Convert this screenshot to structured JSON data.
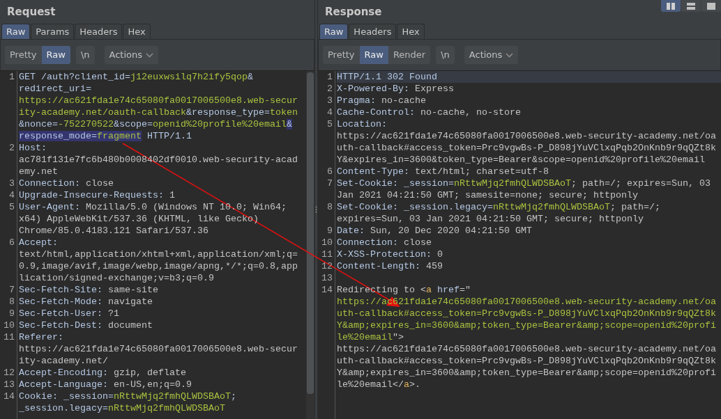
{
  "layout_buttons": [
    {
      "selected": true
    },
    {
      "selected": false
    },
    {
      "selected": false
    }
  ],
  "request": {
    "title": "Request",
    "tabs": [
      {
        "label": "Raw",
        "selected": true
      },
      {
        "label": "Params",
        "selected": false
      },
      {
        "label": "Headers",
        "selected": false
      },
      {
        "label": "Hex",
        "selected": false
      }
    ],
    "view_modes": [
      {
        "label": "Pretty",
        "selected": false
      },
      {
        "label": "Raw",
        "selected": true
      }
    ],
    "newline_button": "\\n",
    "actions_button": "Actions",
    "lines": [
      {
        "number": "1",
        "rows": [
          {
            "tokens": [
              {
                "kind": "key",
                "text": "GET /auth?client_id="
              },
              {
                "kind": "param",
                "text": "j12euxwsilq7h2ify5qop"
              },
              {
                "kind": "key",
                "text": "&"
              }
            ]
          },
          {
            "tokens": [
              {
                "kind": "key",
                "text": "redirect_uri="
              }
            ]
          },
          {
            "tokens": [
              {
                "kind": "param",
                "text": "https://ac621fda1e74c65080fa0017006500e8.web-secur"
              }
            ]
          },
          {
            "tokens": [
              {
                "kind": "param",
                "text": "ity-academy.net/oauth-callback"
              },
              {
                "kind": "key",
                "text": "&response_type="
              },
              {
                "kind": "param",
                "text": "token"
              }
            ]
          },
          {
            "tokens": [
              {
                "kind": "key",
                "text": "&nonce="
              },
              {
                "kind": "param",
                "text": "-752270522"
              },
              {
                "kind": "key",
                "text": "&scope="
              },
              {
                "kind": "param",
                "text": "openid%20profile%20email"
              },
              {
                "kind": "key",
                "text": "&",
                "highlight": true
              }
            ]
          },
          {
            "tokens": [
              {
                "kind": "key",
                "text": "response_mode=",
                "highlight": true
              },
              {
                "kind": "param",
                "text": "fragment",
                "highlight": true
              },
              {
                "kind": "key",
                "text": " HTTP/1.1"
              }
            ]
          }
        ]
      },
      {
        "number": "2",
        "rows": [
          {
            "tokens": [
              {
                "kind": "key",
                "text": "Host:"
              }
            ]
          },
          {
            "tokens": [
              {
                "kind": "text",
                "text": "ac781f131e7fc6b480b0008402df0010.web-security-acad"
              }
            ]
          },
          {
            "tokens": [
              {
                "kind": "text",
                "text": "emy.net"
              }
            ]
          }
        ]
      },
      {
        "number": "3",
        "rows": [
          {
            "tokens": [
              {
                "kind": "key",
                "text": "Connection:"
              },
              {
                "kind": "text",
                "text": " close"
              }
            ]
          }
        ]
      },
      {
        "number": "4",
        "rows": [
          {
            "tokens": [
              {
                "kind": "key",
                "text": "Upgrade-Insecure-Requests:"
              },
              {
                "kind": "text",
                "text": " 1"
              }
            ]
          }
        ]
      },
      {
        "number": "5",
        "rows": [
          {
            "tokens": [
              {
                "kind": "key",
                "text": "User-Agent:"
              },
              {
                "kind": "text",
                "text": " Mozilla/5.0 (Windows NT 10.0; Win64;"
              }
            ]
          },
          {
            "tokens": [
              {
                "kind": "text",
                "text": "x64) AppleWebKit/537.36 (KHTML, like Gecko)"
              }
            ]
          },
          {
            "tokens": [
              {
                "kind": "text",
                "text": "Chrome/85.0.4183.121 Safari/537.36"
              }
            ]
          }
        ]
      },
      {
        "number": "6",
        "rows": [
          {
            "tokens": [
              {
                "kind": "key",
                "text": "Accept:"
              }
            ]
          },
          {
            "tokens": [
              {
                "kind": "text",
                "text": "text/html,application/xhtml+xml,application/xml;q="
              }
            ]
          },
          {
            "tokens": [
              {
                "kind": "text",
                "text": "0.9,image/avif,image/webp,image/apng,*/*;q=0.8,app"
              }
            ]
          },
          {
            "tokens": [
              {
                "kind": "text",
                "text": "lication/signed-exchange;v=b3;q=0.9"
              }
            ]
          }
        ]
      },
      {
        "number": "7",
        "rows": [
          {
            "tokens": [
              {
                "kind": "key",
                "text": "Sec-Fetch-Site:"
              },
              {
                "kind": "text",
                "text": " same-site"
              }
            ]
          }
        ]
      },
      {
        "number": "8",
        "rows": [
          {
            "tokens": [
              {
                "kind": "key",
                "text": "Sec-Fetch-Mode:"
              },
              {
                "kind": "text",
                "text": " navigate"
              }
            ]
          }
        ]
      },
      {
        "number": "9",
        "rows": [
          {
            "tokens": [
              {
                "kind": "key",
                "text": "Sec-Fetch-User:"
              },
              {
                "kind": "text",
                "text": " ?1"
              }
            ]
          }
        ]
      },
      {
        "number": "10",
        "rows": [
          {
            "tokens": [
              {
                "kind": "key",
                "text": "Sec-Fetch-Dest:"
              },
              {
                "kind": "text",
                "text": " document"
              }
            ]
          }
        ]
      },
      {
        "number": "11",
        "rows": [
          {
            "tokens": [
              {
                "kind": "key",
                "text": "Referer:"
              }
            ]
          },
          {
            "tokens": [
              {
                "kind": "text",
                "text": "https://ac621fda1e74c65080fa0017006500e8.web-secur"
              }
            ]
          },
          {
            "tokens": [
              {
                "kind": "text",
                "text": "ity-academy.net/"
              }
            ]
          }
        ]
      },
      {
        "number": "12",
        "rows": [
          {
            "tokens": [
              {
                "kind": "key",
                "text": "Accept-Encoding:"
              },
              {
                "kind": "text",
                "text": " gzip, deflate"
              }
            ]
          }
        ]
      },
      {
        "number": "13",
        "rows": [
          {
            "tokens": [
              {
                "kind": "key",
                "text": "Accept-Language:"
              },
              {
                "kind": "text",
                "text": " en-US,en;q=0.9"
              }
            ]
          }
        ]
      },
      {
        "number": "14",
        "rows": [
          {
            "tokens": [
              {
                "kind": "key",
                "text": "Cookie: _session="
              },
              {
                "kind": "param",
                "text": "nRttwMjq2fmhQLWDSBAoT"
              },
              {
                "kind": "key",
                "text": ";"
              }
            ]
          },
          {
            "tokens": [
              {
                "kind": "key",
                "text": "_session.legacy="
              },
              {
                "kind": "param",
                "text": "nRttwMjq2fmhQLWDSBAoT"
              }
            ]
          }
        ]
      }
    ]
  },
  "response": {
    "title": "Response",
    "tabs": [
      {
        "label": "Raw",
        "selected": true
      },
      {
        "label": "Headers",
        "selected": false
      },
      {
        "label": "Hex",
        "selected": false
      }
    ],
    "view_modes": [
      {
        "label": "Pretty",
        "selected": false
      },
      {
        "label": "Raw",
        "selected": true
      },
      {
        "label": "Render",
        "selected": false
      }
    ],
    "newline_button": "\\n",
    "actions_button": "Actions",
    "lines": [
      {
        "number": "1",
        "current": true,
        "rows": [
          {
            "tokens": [
              {
                "kind": "key",
                "text": "HTTP/1.1 302 Found"
              }
            ]
          }
        ]
      },
      {
        "number": "2",
        "rows": [
          {
            "tokens": [
              {
                "kind": "key",
                "text": "X-Powered-By:"
              },
              {
                "kind": "text",
                "text": " Express"
              }
            ]
          }
        ]
      },
      {
        "number": "3",
        "rows": [
          {
            "tokens": [
              {
                "kind": "key",
                "text": "Pragma:"
              },
              {
                "kind": "text",
                "text": " no-cache"
              }
            ]
          }
        ]
      },
      {
        "number": "4",
        "rows": [
          {
            "tokens": [
              {
                "kind": "key",
                "text": "Cache-Control:"
              },
              {
                "kind": "text",
                "text": " no-cache, no-store"
              }
            ]
          }
        ]
      },
      {
        "number": "5",
        "rows": [
          {
            "tokens": [
              {
                "kind": "key",
                "text": "Location:"
              }
            ]
          },
          {
            "tokens": [
              {
                "kind": "text",
                "text": "https://ac621fda1e74c65080fa0017006500e8.web-security-academy.net/oa"
              }
            ]
          },
          {
            "tokens": [
              {
                "kind": "text",
                "text": "uth-callback#access_token=Prc9vgwBs-P_D898jYuVClxqPqb2OnKnb9r9qQZt8k"
              }
            ]
          },
          {
            "tokens": [
              {
                "kind": "text",
                "text": "Y&expires_in=3600&token_type=Bearer&scope=openid%20profile%20email"
              }
            ]
          }
        ]
      },
      {
        "number": "6",
        "rows": [
          {
            "tokens": [
              {
                "kind": "key",
                "text": "Content-Type:"
              },
              {
                "kind": "text",
                "text": " text/html; charset=utf-8"
              }
            ]
          }
        ]
      },
      {
        "number": "7",
        "rows": [
          {
            "tokens": [
              {
                "kind": "key",
                "text": "Set-Cookie: _session="
              },
              {
                "kind": "param",
                "text": "nRttwMjq2fmhQLWDSBAoT"
              },
              {
                "kind": "text",
                "text": "; path=/; expires=Sun, 03"
              }
            ]
          },
          {
            "tokens": [
              {
                "kind": "text",
                "text": "Jan 2021 04:21:50 GMT; samesite=none; secure; httponly"
              }
            ]
          }
        ]
      },
      {
        "number": "8",
        "rows": [
          {
            "tokens": [
              {
                "kind": "key",
                "text": "Set-Cookie: _session.legacy="
              },
              {
                "kind": "param",
                "text": "nRttwMjq2fmhQLWDSBAoT"
              },
              {
                "kind": "text",
                "text": "; path=/;"
              }
            ]
          },
          {
            "tokens": [
              {
                "kind": "text",
                "text": "expires=Sun, 03 Jan 2021 04:21:50 GMT; secure; httponly"
              }
            ]
          }
        ]
      },
      {
        "number": "9",
        "rows": [
          {
            "tokens": [
              {
                "kind": "key",
                "text": "Date:"
              },
              {
                "kind": "text",
                "text": " Sun, 20 Dec 2020 04:21:50 GMT"
              }
            ]
          }
        ]
      },
      {
        "number": "10",
        "rows": [
          {
            "tokens": [
              {
                "kind": "key",
                "text": "Connection:"
              },
              {
                "kind": "text",
                "text": " close"
              }
            ]
          }
        ]
      },
      {
        "number": "11",
        "rows": [
          {
            "tokens": [
              {
                "kind": "key",
                "text": "X-XSS-Protection:"
              },
              {
                "kind": "text",
                "text": " 0"
              }
            ]
          }
        ]
      },
      {
        "number": "12",
        "rows": [
          {
            "tokens": [
              {
                "kind": "key",
                "text": "Content-Length:"
              },
              {
                "kind": "text",
                "text": " 459"
              }
            ]
          }
        ]
      },
      {
        "number": "13"
      },
      {
        "number": "14",
        "rows": [
          {
            "tokens": [
              {
                "kind": "text",
                "text": "Redirecting to <"
              },
              {
                "kind": "tag",
                "text": "a"
              },
              {
                "kind": "key",
                "text": " href"
              },
              {
                "kind": "text",
                "text": "=\""
              }
            ]
          },
          {
            "tokens": [
              {
                "kind": "param",
                "text": "https://ac621fda1e74c65080fa0017006500e8.web-security-academy.net/oa"
              }
            ]
          },
          {
            "tokens": [
              {
                "kind": "param",
                "text": "uth-callback#access_token=Prc9vgwBs-P_D898jYuVClxqPqb2OnKnb9r9qQZt8k"
              }
            ]
          },
          {
            "tokens": [
              {
                "kind": "param",
                "text": "Y&amp;expires_in=3600&amp;token_type=Bearer&amp;scope=openid%20profi"
              }
            ]
          },
          {
            "tokens": [
              {
                "kind": "param",
                "text": "le%20email"
              },
              {
                "kind": "text",
                "text": "\">"
              }
            ]
          },
          {
            "tokens": [
              {
                "kind": "text",
                "text": "https://ac621fda1e74c65080fa0017006500e8.web-security-academy.net/oa"
              }
            ]
          },
          {
            "tokens": [
              {
                "kind": "text",
                "text": "uth-callback#access_token=Prc9vgwBs-P_D898jYuVClxqPqb2OnKnb9r9qQZt8k"
              }
            ]
          },
          {
            "tokens": [
              {
                "kind": "text",
                "text": "Y&amp;expires_in=3600&amp;token_type=Bearer&amp;scope=openid%20profi"
              }
            ]
          },
          {
            "tokens": [
              {
                "kind": "text",
                "text": "le%20email</"
              },
              {
                "kind": "tag",
                "text": "a"
              },
              {
                "kind": "text",
                "text": ">."
              }
            ]
          }
        ]
      }
    ]
  }
}
